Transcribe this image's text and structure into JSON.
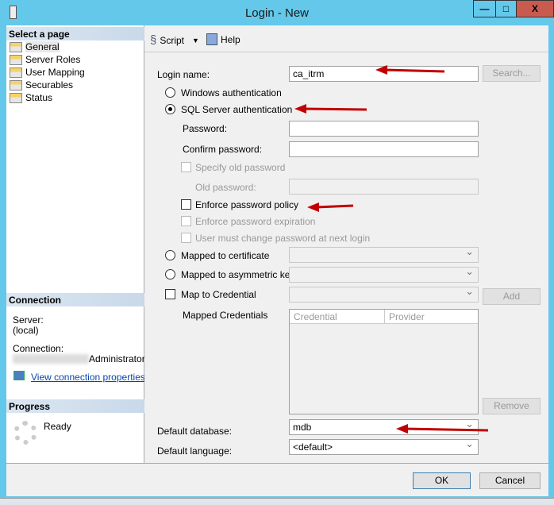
{
  "window": {
    "title": "Login - New",
    "minimize": "—",
    "maximize": "□",
    "close": "X"
  },
  "sidebar": {
    "select_header": "Select a page",
    "pages": [
      "General",
      "Server Roles",
      "User Mapping",
      "Securables",
      "Status"
    ],
    "connection_header": "Connection",
    "server_label": "Server:",
    "server_value": "(local)",
    "connection_label": "Connection:",
    "connection_value": "Administrator",
    "view_props": "View connection properties",
    "progress_header": "Progress",
    "progress_status": "Ready"
  },
  "toolbar": {
    "script": "Script",
    "help": "Help"
  },
  "form": {
    "login_name_label": "Login name:",
    "login_name_value": "ca_itrm",
    "search": "Search...",
    "windows_auth": "Windows authentication",
    "sql_auth": "SQL Server authentication",
    "password_label": "Password:",
    "confirm_label": "Confirm password:",
    "specify_old": "Specify old password",
    "old_password_label": "Old password:",
    "enforce_policy": "Enforce password policy",
    "enforce_expiration": "Enforce password expiration",
    "must_change": "User must change password at next login",
    "mapped_cert": "Mapped to certificate",
    "mapped_asym": "Mapped to asymmetric key",
    "map_credential": "Map to Credential",
    "add": "Add",
    "mapped_credentials": "Mapped Credentials",
    "grid_headers": [
      "Credential",
      "Provider"
    ],
    "remove": "Remove",
    "default_db_label": "Default database:",
    "default_db_value": "mdb",
    "default_lang_label": "Default language:",
    "default_lang_value": "<default>"
  },
  "footer": {
    "ok": "OK",
    "cancel": "Cancel"
  },
  "colors": {
    "titlebar": "#63c8ea",
    "close": "#c75b50",
    "arrow": "#c00000"
  }
}
